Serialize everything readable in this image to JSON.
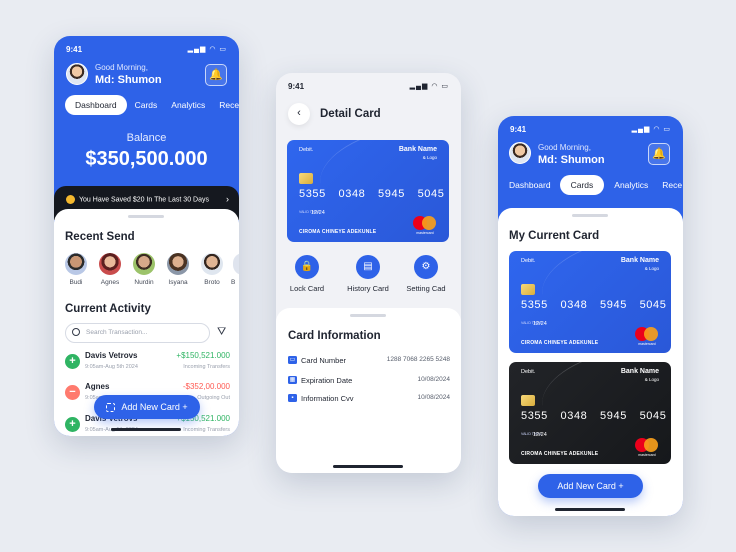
{
  "status": {
    "time": "9:41",
    "icons": "▂▄▆ ◠ ▭"
  },
  "dashboard_screen": {
    "greeting": "Good Morning,",
    "user_name": "Md: Shumon",
    "tabs": [
      "Dashboard",
      "Cards",
      "Analytics",
      "Rece"
    ],
    "active_tab": "Dashboard",
    "balance_label": "Balance",
    "balance_value": "$350,500.000",
    "saved_banner": "You Have Saved $20 In The Last 30 Days",
    "recent_send_title": "Recent Send",
    "contacts": [
      "Budi",
      "Agnes",
      "Nurdin",
      "Isyana",
      "Broto",
      "B"
    ],
    "current_activity_title": "Current Activity",
    "search_placeholder": "Search Transaction...",
    "transactions": [
      {
        "name": "Davis Vetrovs",
        "date": "9:05am-Aug 5th 2024",
        "amount": "+$150,521.000",
        "type": "Incoming Transfers",
        "direction": "in"
      },
      {
        "name": "Agnes",
        "date": "9:05am-Aug 5th 2024",
        "amount": "-$352,00.000",
        "type": "Outgoing Out",
        "direction": "out"
      },
      {
        "name": "Davis Vetrovs",
        "date": "9:05am-Aug 5th 2024",
        "amount": "+$150,521.000",
        "type": "Incoming Transfers",
        "direction": "in"
      }
    ],
    "add_button": "Add New Card +"
  },
  "detail_screen": {
    "title": "Detail Card",
    "card": {
      "type": "Debit.",
      "bank": "Bank Name",
      "logo_text": "& Logo",
      "number": "5355 0348 5945 5045",
      "valid_label": "VALID THRU",
      "expiry": "12/24",
      "holder": "CIROMA CHINEYE ADEKUNLE",
      "network": "mastercard"
    },
    "actions": [
      "Lock Card",
      "History Card",
      "Setting Cad"
    ],
    "info_title": "Card Information",
    "info_rows": [
      {
        "label": "Card Number",
        "value": "1288 7068 2265 5248"
      },
      {
        "label": "Expiration Date",
        "value": "10/08/2024"
      },
      {
        "label": "Information Cvv",
        "value": "10/08/2024"
      }
    ]
  },
  "cards_screen": {
    "greeting": "Good Morning,",
    "user_name": "Md: Shumon",
    "tabs": [
      "Dashboard",
      "Cards",
      "Analytics",
      "Rece"
    ],
    "active_tab": "Cards",
    "section_title": "My Current Card",
    "cards": [
      {
        "type": "Debit.",
        "bank": "Bank Name",
        "logo_text": "& Logo",
        "number": "5355 0348 5945 5045",
        "valid_label": "VALID THRU",
        "expiry": "12/24",
        "holder": "CIROMA CHINEYE ADEKUNLE",
        "network": "mastercard",
        "color": "#2e62e8"
      },
      {
        "type": "Debit.",
        "bank": "Bank Name",
        "logo_text": "& Logo",
        "number": "5355 0348 5945 5045",
        "valid_label": "VALID THRU",
        "expiry": "12/24",
        "holder": "CIROMA CHINEYE ADEKUNLE",
        "network": "mastercard",
        "color": "#1c1e22"
      }
    ],
    "add_button": "Add New Card +"
  },
  "colors": {
    "primary": "#2e62e8",
    "positive": "#2fb463",
    "negative": "#ff5a52",
    "dark_banner": "#15181f"
  },
  "icons": [
    "bell-icon",
    "back-arrow-icon",
    "lock-icon",
    "history-icon",
    "settings-icon",
    "search-icon",
    "filter-icon",
    "plus-icon",
    "minus-icon",
    "scan-icon",
    "chip-icon",
    "mastercard-icon",
    "card-icon",
    "calendar-icon"
  ]
}
